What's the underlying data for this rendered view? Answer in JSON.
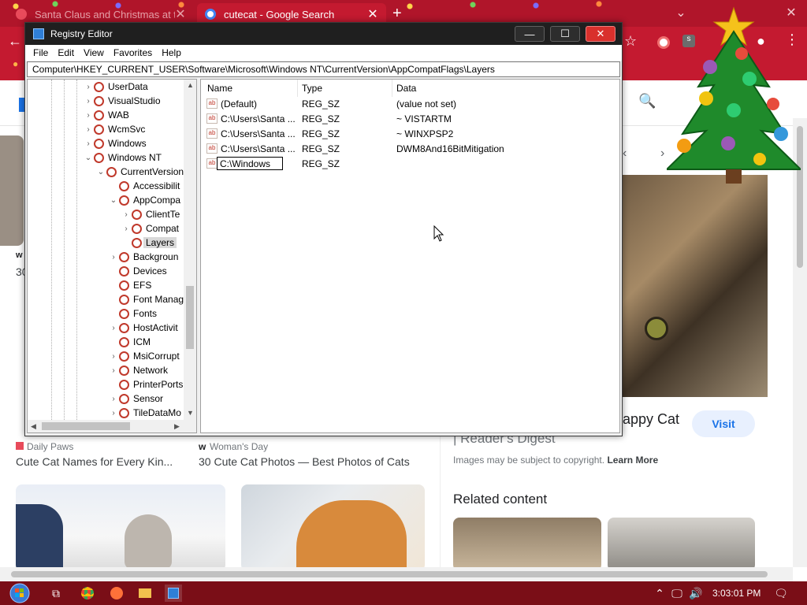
{
  "chrome": {
    "tabs": [
      {
        "title": "Santa Claus and Christmas at th",
        "active": false
      },
      {
        "title": "cutecat - Google Search",
        "active": true
      }
    ],
    "new_tab": "+"
  },
  "results": [
    {
      "source": "Daily Paws",
      "title": "Cute Cat Names for Every Kin..."
    },
    {
      "source": "Woman's Day",
      "title": "30 Cute Cat Photos — Best Photos of Cats"
    }
  ],
  "left_partial": {
    "w": "w",
    "n": "30"
  },
  "panel": {
    "title_partial": "appy Cat",
    "source_line": "| Reader's Digest",
    "visit_label": "Visit",
    "copyright_text": "Images may be subject to copyright.",
    "learn_more": "Learn More",
    "related_title": "Related content"
  },
  "regedit": {
    "title": "Registry Editor",
    "menu": [
      "File",
      "Edit",
      "View",
      "Favorites",
      "Help"
    ],
    "address": "Computer\\HKEY_CURRENT_USER\\Software\\Microsoft\\Windows NT\\CurrentVersion\\AppCompatFlags\\Layers",
    "tree": [
      {
        "label": "UserData",
        "level": 0,
        "arrow": "right"
      },
      {
        "label": "VisualStudio",
        "level": 0,
        "arrow": "right"
      },
      {
        "label": "WAB",
        "level": 0,
        "arrow": "right"
      },
      {
        "label": "WcmSvc",
        "level": 0,
        "arrow": "right"
      },
      {
        "label": "Windows",
        "level": 0,
        "arrow": "right"
      },
      {
        "label": "Windows NT",
        "level": 0,
        "arrow": "down"
      },
      {
        "label": "CurrentVersion",
        "level": 1,
        "arrow": "down"
      },
      {
        "label": "Accessibilit",
        "level": 2,
        "arrow": ""
      },
      {
        "label": "AppCompa",
        "level": 2,
        "arrow": "down"
      },
      {
        "label": "ClientTe",
        "level": 3,
        "arrow": "right"
      },
      {
        "label": "Compat",
        "level": 3,
        "arrow": "right"
      },
      {
        "label": "Layers",
        "level": 3,
        "arrow": "",
        "selected": true
      },
      {
        "label": "Backgroun",
        "level": 2,
        "arrow": "right"
      },
      {
        "label": "Devices",
        "level": 2,
        "arrow": ""
      },
      {
        "label": "EFS",
        "level": 2,
        "arrow": ""
      },
      {
        "label": "Font Manag",
        "level": 2,
        "arrow": ""
      },
      {
        "label": "Fonts",
        "level": 2,
        "arrow": ""
      },
      {
        "label": "HostActivit",
        "level": 2,
        "arrow": "right"
      },
      {
        "label": "ICM",
        "level": 2,
        "arrow": ""
      },
      {
        "label": "MsiCorrupt",
        "level": 2,
        "arrow": "right"
      },
      {
        "label": "Network",
        "level": 2,
        "arrow": "right"
      },
      {
        "label": "PrinterPorts",
        "level": 2,
        "arrow": ""
      },
      {
        "label": "Sensor",
        "level": 2,
        "arrow": "right"
      },
      {
        "label": "TileDataMo",
        "level": 2,
        "arrow": "right"
      }
    ],
    "columns": {
      "name": "Name",
      "type": "Type",
      "data": "Data"
    },
    "values": [
      {
        "name": "(Default)",
        "type": "REG_SZ",
        "data": "(value not set)"
      },
      {
        "name": "C:\\Users\\Santa ...",
        "type": "REG_SZ",
        "data": "~ VISTARTM"
      },
      {
        "name": "C:\\Users\\Santa ...",
        "type": "REG_SZ",
        "data": "~ WINXPSP2"
      },
      {
        "name": "C:\\Users\\Santa ...",
        "type": "REG_SZ",
        "data": "DWM8And16BitMitigation"
      },
      {
        "name": "C:\\Windows",
        "type": "REG_SZ",
        "data": "",
        "editing": true
      }
    ]
  },
  "taskbar": {
    "clock": "3:03:01 PM"
  },
  "colors": {
    "chrome_red": "#c41a30",
    "tabbar_red": "#b0152a",
    "taskbar": "#7a0e17",
    "accent_blue": "#1a73e8"
  }
}
